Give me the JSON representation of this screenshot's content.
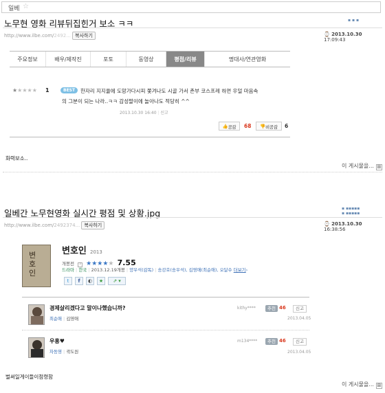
{
  "top_bar": {
    "title": "일베"
  },
  "post1": {
    "title": "노무현 영화 리뷰뒤집힌거 보소 ㅋㅋ",
    "url": "http://www.ilbe.com/",
    "url_blurred": "2492...",
    "copy_label": "복사하기",
    "date": "2013.10.30",
    "time": "17:09:43",
    "tabs": [
      "주요정보",
      "배우/제작진",
      "포토",
      "동영상",
      "평점/리뷰",
      "명대사/연관영화"
    ],
    "active_tab": "평점/리뷰",
    "review": {
      "rating": "1",
      "rating_value": 1,
      "badge": "BEST",
      "text_line1": "한자리 지지율에 도망가다시피 쫓겨나도 시골 가서 촌부 코스프레 하면 우덜 마음속",
      "text_line2": "의 그분이 되는 나라..ㅋㅋ 감성팔이에 놀아나도 적당히 ^^",
      "date": "2013.10.30 16:40",
      "separator": "|",
      "report": "신고",
      "like_label": "공감",
      "like_count": "68",
      "dislike_label": "비공감",
      "dislike_count": "6"
    },
    "body_text": "화력보소..",
    "more_label": "이 게시물을..."
  },
  "post2": {
    "title": "일베간 노무현영화 실시간 평점 및 상황.jpg",
    "url": "http://www.ilbe.com/",
    "url_blurred": "2492374...",
    "copy_label": "복사하기",
    "date": "2013.10.30",
    "time": "16:38:56",
    "movie": {
      "title": "변호인",
      "year": "2013",
      "status_label": "개봉전",
      "rating": "7.55",
      "rating_value": 7.55,
      "poster_text": "변호인",
      "genre": "드라마",
      "country": "한국",
      "release": "2013.12.19개봉",
      "director": "양우석(감독)",
      "cast": "송강호(송우석), 김영애(최순애), 오달수",
      "more_link": "더보기"
    },
    "comments": [
      {
        "text": "경제살리겠다고 말이나했습니까?",
        "character": "최순애",
        "separator": "|",
        "actor": "김영애",
        "user": "kithy****",
        "recommend_label": "추천",
        "count": "46",
        "report": "신고",
        "date": "2013.04.05"
      },
      {
        "text": "우홍♥",
        "character": "차동영",
        "separator": "|",
        "actor": "곽도원",
        "user": "m134****",
        "recommend_label": "추천",
        "count": "46",
        "report": "신고",
        "date": "2013.04.05"
      }
    ],
    "body_text": "벌써일게이들이점령함",
    "more_label": "이 게시물을..."
  },
  "colors": {
    "active_tab_bg": "#888888",
    "count_red": "#d9381e",
    "best_badge": "#7ec0e5",
    "link_blue": "#3b6fb6",
    "genre_green": "#2e8b57"
  }
}
